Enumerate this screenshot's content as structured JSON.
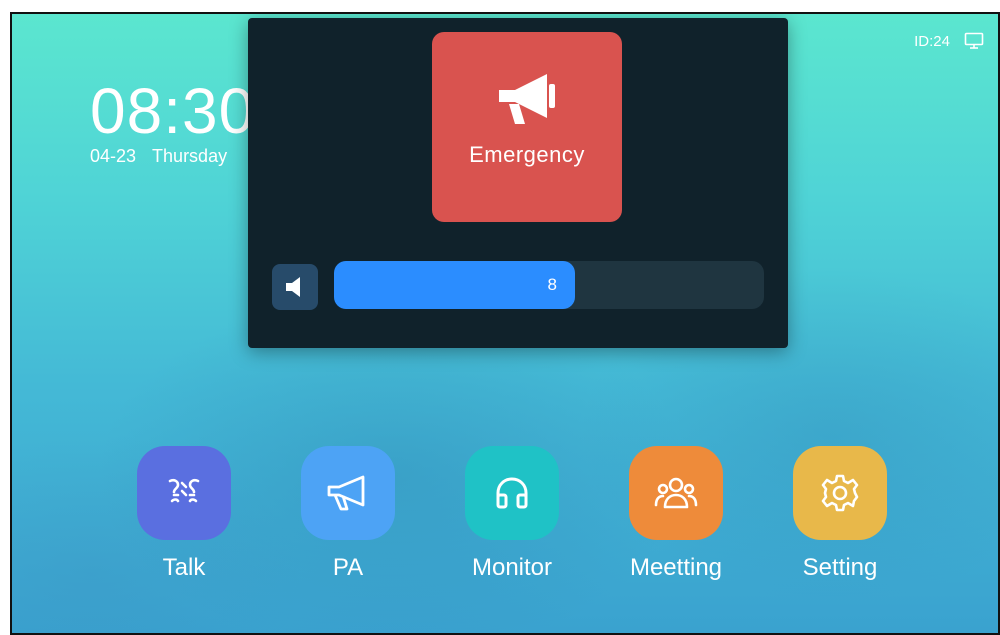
{
  "status": {
    "id_text": "ID:24",
    "connection_icon": "monitor-icon"
  },
  "clock": {
    "time": "08:30",
    "date": "04-23",
    "weekday": "Thursday"
  },
  "emergency": {
    "label": "Emergency",
    "icon": "megaphone-icon",
    "color": "#d9534f"
  },
  "volume": {
    "value": "8",
    "level_fraction": 0.56,
    "icon": "speaker-icon",
    "accent": "#2b8dff"
  },
  "dock": {
    "items": [
      {
        "label": "Talk",
        "icon": "talk-icon",
        "color": "#5a6fe0"
      },
      {
        "label": "PA",
        "icon": "megaphone-icon",
        "color": "#4da3f5"
      },
      {
        "label": "Monitor",
        "icon": "headphones-icon",
        "color": "#1fc2c6"
      },
      {
        "label": "Meetting",
        "icon": "group-icon",
        "color": "#ee8b3a"
      },
      {
        "label": "Setting",
        "icon": "gear-icon",
        "color": "#e8b84a"
      }
    ]
  }
}
